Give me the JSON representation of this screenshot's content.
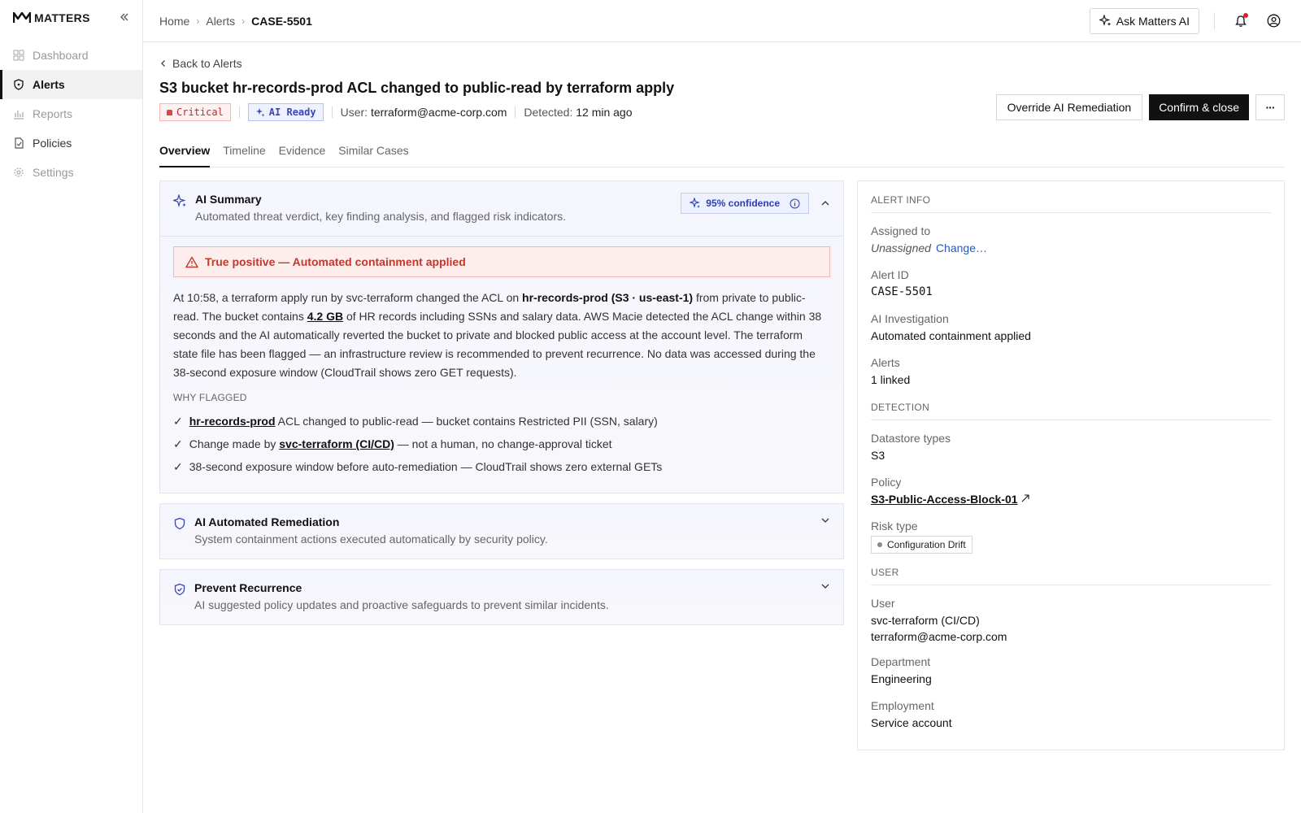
{
  "brand": {
    "name": "MATTERS"
  },
  "sidebar": {
    "items": [
      {
        "label": "Dashboard",
        "icon": "grid-icon",
        "state": "disabled"
      },
      {
        "label": "Alerts",
        "icon": "shield-icon",
        "state": "active"
      },
      {
        "label": "Reports",
        "icon": "bar-chart-icon",
        "state": "disabled"
      },
      {
        "label": "Policies",
        "icon": "document-icon",
        "state": "enabled"
      },
      {
        "label": "Settings",
        "icon": "gear-icon",
        "state": "disabled"
      }
    ]
  },
  "breadcrumb": {
    "home": "Home",
    "alerts": "Alerts",
    "current": "CASE-5501"
  },
  "topbar": {
    "ask_label": "Ask Matters AI"
  },
  "page": {
    "back_label": "Back to Alerts",
    "title": "S3 bucket hr-records-prod ACL changed to public-read by terraform apply",
    "severity": "Critical",
    "ai_status": "AI Ready",
    "user_label": "User:",
    "user_value": "terraform@acme-corp.com",
    "detected_label": "Detected:",
    "detected_value": "12 min ago",
    "override_label": "Override AI Remediation",
    "confirm_label": "Confirm & close",
    "more_label": "···"
  },
  "tabs": [
    "Overview",
    "Timeline",
    "Evidence",
    "Similar Cases"
  ],
  "ai_summary": {
    "title": "AI Summary",
    "subtitle": "Automated threat verdict, key finding analysis, and flagged risk indicators.",
    "confidence": "95% confidence",
    "verdict": "True positive — Automated containment applied",
    "text": {
      "p1": "At 10:58, a terraform apply run by svc-terraform changed the ACL on ",
      "b1": "hr-records-prod (S3 · us-east-1)",
      "p2": " from private to public-read. The bucket contains ",
      "b2": "4.2 GB",
      "p3": " of HR records including SSNs and salary data. AWS Macie detected the ACL change within 38 seconds and the AI automatically reverted the bucket to private and blocked public access at the account level. The terraform state file has been flagged — an infrastructure review is recommended to prevent recurrence. No data was accessed during the 38-second exposure window (CloudTrail shows zero GET requests)."
    },
    "why_label": "WHY FLAGGED",
    "why": [
      {
        "pre": "",
        "bold": "hr-records-prod",
        "post": " ACL changed to public-read — bucket contains Restricted PII (SSN, salary)"
      },
      {
        "pre": "Change made by ",
        "bold": "svc-terraform (CI/CD)",
        "post": " — not a human, no change-approval ticket"
      },
      {
        "pre": "38-second exposure window before auto-remediation — CloudTrail shows zero external GETs",
        "bold": "",
        "post": ""
      }
    ]
  },
  "remediation": {
    "title": "AI Automated Remediation",
    "subtitle": "System containment actions executed automatically by security policy."
  },
  "recurrence": {
    "title": "Prevent Recurrence",
    "subtitle": "AI suggested policy updates and proactive safeguards to prevent similar incidents."
  },
  "alert_info": {
    "section": "ALERT INFO",
    "assigned_label": "Assigned to",
    "assigned_value": "Unassigned",
    "change_label": "Change…",
    "id_label": "Alert ID",
    "id_value": "CASE-5501",
    "investigation_label": "AI Investigation",
    "investigation_value": "Automated containment applied",
    "alerts_label": "Alerts",
    "alerts_value": "1 linked"
  },
  "detection": {
    "section": "DETECTION",
    "datastore_label": "Datastore types",
    "datastore_value": "S3",
    "policy_label": "Policy",
    "policy_value": "S3-Public-Access-Block-01",
    "risk_label": "Risk type",
    "risk_value": "Configuration Drift"
  },
  "user": {
    "section": "USER",
    "user_label": "User",
    "user_name": "svc-terraform (CI/CD)",
    "user_email": "terraform@acme-corp.com",
    "dept_label": "Department",
    "dept_value": "Engineering",
    "emp_label": "Employment",
    "emp_value": "Service account"
  },
  "colors": {
    "accent_blue": "#2e3fb0",
    "critical_red": "#c0262d",
    "primary_dark": "#111111"
  }
}
